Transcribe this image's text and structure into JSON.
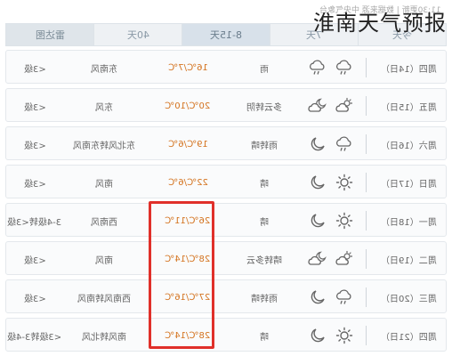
{
  "headline": "淮南天气预报",
  "source_line": "11:30更新 | 数据来源 中央气象台",
  "tabs": [
    {
      "label": "雷达图",
      "active": false
    },
    {
      "label": "40天",
      "active": false
    },
    {
      "label": "8-15天",
      "active": true
    },
    {
      "label": "7天",
      "active": false
    },
    {
      "label": "今天",
      "active": false
    }
  ],
  "rows": [
    {
      "day": "周四（14日）",
      "day_icon": "cloud-rain-icon",
      "night_icon": "cloud-rain-icon",
      "weather": "雨",
      "temp": "16℃/7℃",
      "wind": "东南风",
      "power": "<3级"
    },
    {
      "day": "周五（15日）",
      "day_icon": "partly-cloudy-icon",
      "night_icon": "cloud-moon-icon",
      "weather": "多云转阴",
      "temp": "20℃/10℃",
      "wind": "东风",
      "power": "<3级"
    },
    {
      "day": "周六（16日）",
      "day_icon": "cloud-rain-icon",
      "night_icon": "moon-icon",
      "weather": "雨转晴",
      "temp": "19℃/6℃",
      "wind": "东北风转东南风",
      "power": "<3级"
    },
    {
      "day": "周日（17日）",
      "day_icon": "sun-icon",
      "night_icon": "moon-icon",
      "weather": "晴",
      "temp": "22℃/6℃",
      "wind": "南风",
      "power": "<3级"
    },
    {
      "day": "周一（18日）",
      "day_icon": "sun-icon",
      "night_icon": "moon-icon",
      "weather": "晴",
      "temp": "26℃/11℃",
      "wind": "西南风",
      "power": "3-4级转<3级"
    },
    {
      "day": "周二（19日）",
      "day_icon": "partly-cloudy-icon",
      "night_icon": "cloud-moon-icon",
      "weather": "晴转多云",
      "temp": "28℃/14℃",
      "wind": "南风",
      "power": "<3级"
    },
    {
      "day": "周三（20日）",
      "day_icon": "cloud-rain-icon",
      "night_icon": "moon-icon",
      "weather": "雨转晴",
      "temp": "27℃/16℃",
      "wind": "西南风转南风",
      "power": "<3级"
    },
    {
      "day": "周四（21日）",
      "day_icon": "sun-icon",
      "night_icon": "moon-icon",
      "weather": "晴",
      "temp": "28℃/14℃",
      "wind": "南风转北风",
      "power": "<3级转3-4级"
    }
  ],
  "colors": {
    "temp": "#d4731f",
    "highlight_box": "#e0302a",
    "active_tab": "#d8e1ea"
  }
}
